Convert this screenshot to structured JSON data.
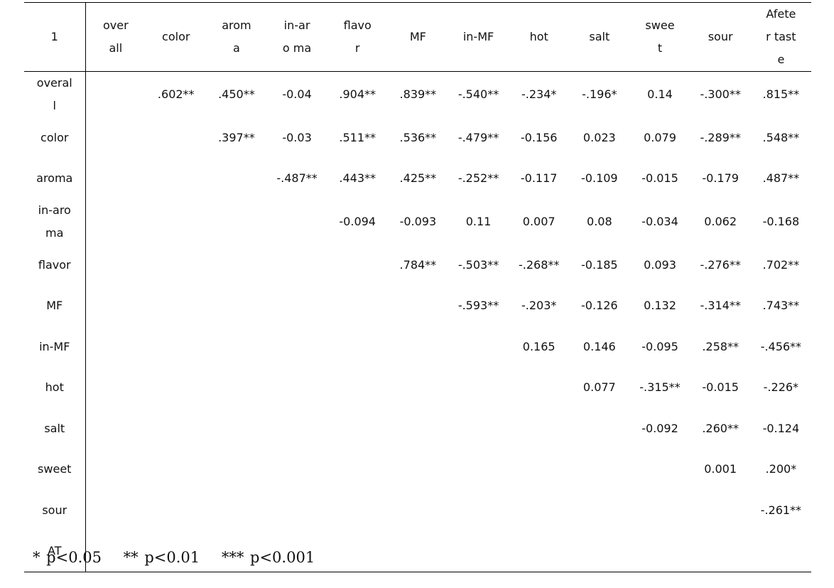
{
  "table": {
    "corner": "1",
    "columns": [
      "overall",
      "color",
      "aroma",
      "in-aro ma",
      "flavor",
      "MF",
      "in-MF",
      "hot",
      "salt",
      "sweet",
      "sour",
      "Afeter taste"
    ],
    "rows": [
      {
        "label": "overall",
        "cells": [
          "",
          ".602**",
          ".450**",
          "-0.04",
          ".904**",
          ".839**",
          "-.540**",
          "-.234*",
          "-.196*",
          "0.14",
          "-.300**",
          ".815**"
        ]
      },
      {
        "label": "color",
        "cells": [
          "",
          "",
          ".397**",
          "-0.03",
          ".511**",
          ".536**",
          "-.479**",
          "-0.156",
          "0.023",
          "0.079",
          "-.289**",
          ".548**"
        ]
      },
      {
        "label": "aroma",
        "cells": [
          "",
          "",
          "",
          "-.487**",
          ".443**",
          ".425**",
          "-.252**",
          "-0.117",
          "-0.109",
          "-0.015",
          "-0.179",
          ".487**"
        ]
      },
      {
        "label": "in-aro ma",
        "cells": [
          "",
          "",
          "",
          "",
          "-0.094",
          "-0.093",
          "0.11",
          "0.007",
          "0.08",
          "-0.034",
          "0.062",
          "-0.168"
        ]
      },
      {
        "label": "flavor",
        "cells": [
          "",
          "",
          "",
          "",
          "",
          ".784**",
          "-.503**",
          "-.268**",
          "-0.185",
          "0.093",
          "-.276**",
          ".702**"
        ]
      },
      {
        "label": "MF",
        "cells": [
          "",
          "",
          "",
          "",
          "",
          "",
          "-.593**",
          "-.203*",
          "-0.126",
          "0.132",
          "-.314**",
          ".743**"
        ]
      },
      {
        "label": "in-MF",
        "cells": [
          "",
          "",
          "",
          "",
          "",
          "",
          "",
          "0.165",
          "0.146",
          "-0.095",
          ".258**",
          "-.456**"
        ]
      },
      {
        "label": "hot",
        "cells": [
          "",
          "",
          "",
          "",
          "",
          "",
          "",
          "",
          "0.077",
          "-.315**",
          "-0.015",
          "-.226*"
        ]
      },
      {
        "label": "salt",
        "cells": [
          "",
          "",
          "",
          "",
          "",
          "",
          "",
          "",
          "",
          "-0.092",
          ".260**",
          "-0.124"
        ]
      },
      {
        "label": "sweet",
        "cells": [
          "",
          "",
          "",
          "",
          "",
          "",
          "",
          "",
          "",
          "",
          "0.001",
          ".200*"
        ]
      },
      {
        "label": "sour",
        "cells": [
          "",
          "",
          "",
          "",
          "",
          "",
          "",
          "",
          "",
          "",
          "",
          "-.261**"
        ]
      },
      {
        "label": "AT",
        "cells": [
          "",
          "",
          "",
          "",
          "",
          "",
          "",
          "",
          "",
          "",
          "",
          ""
        ]
      }
    ]
  },
  "footnote": [
    "* p<0.05",
    "** p<0.01",
    "*** p<0.001"
  ]
}
